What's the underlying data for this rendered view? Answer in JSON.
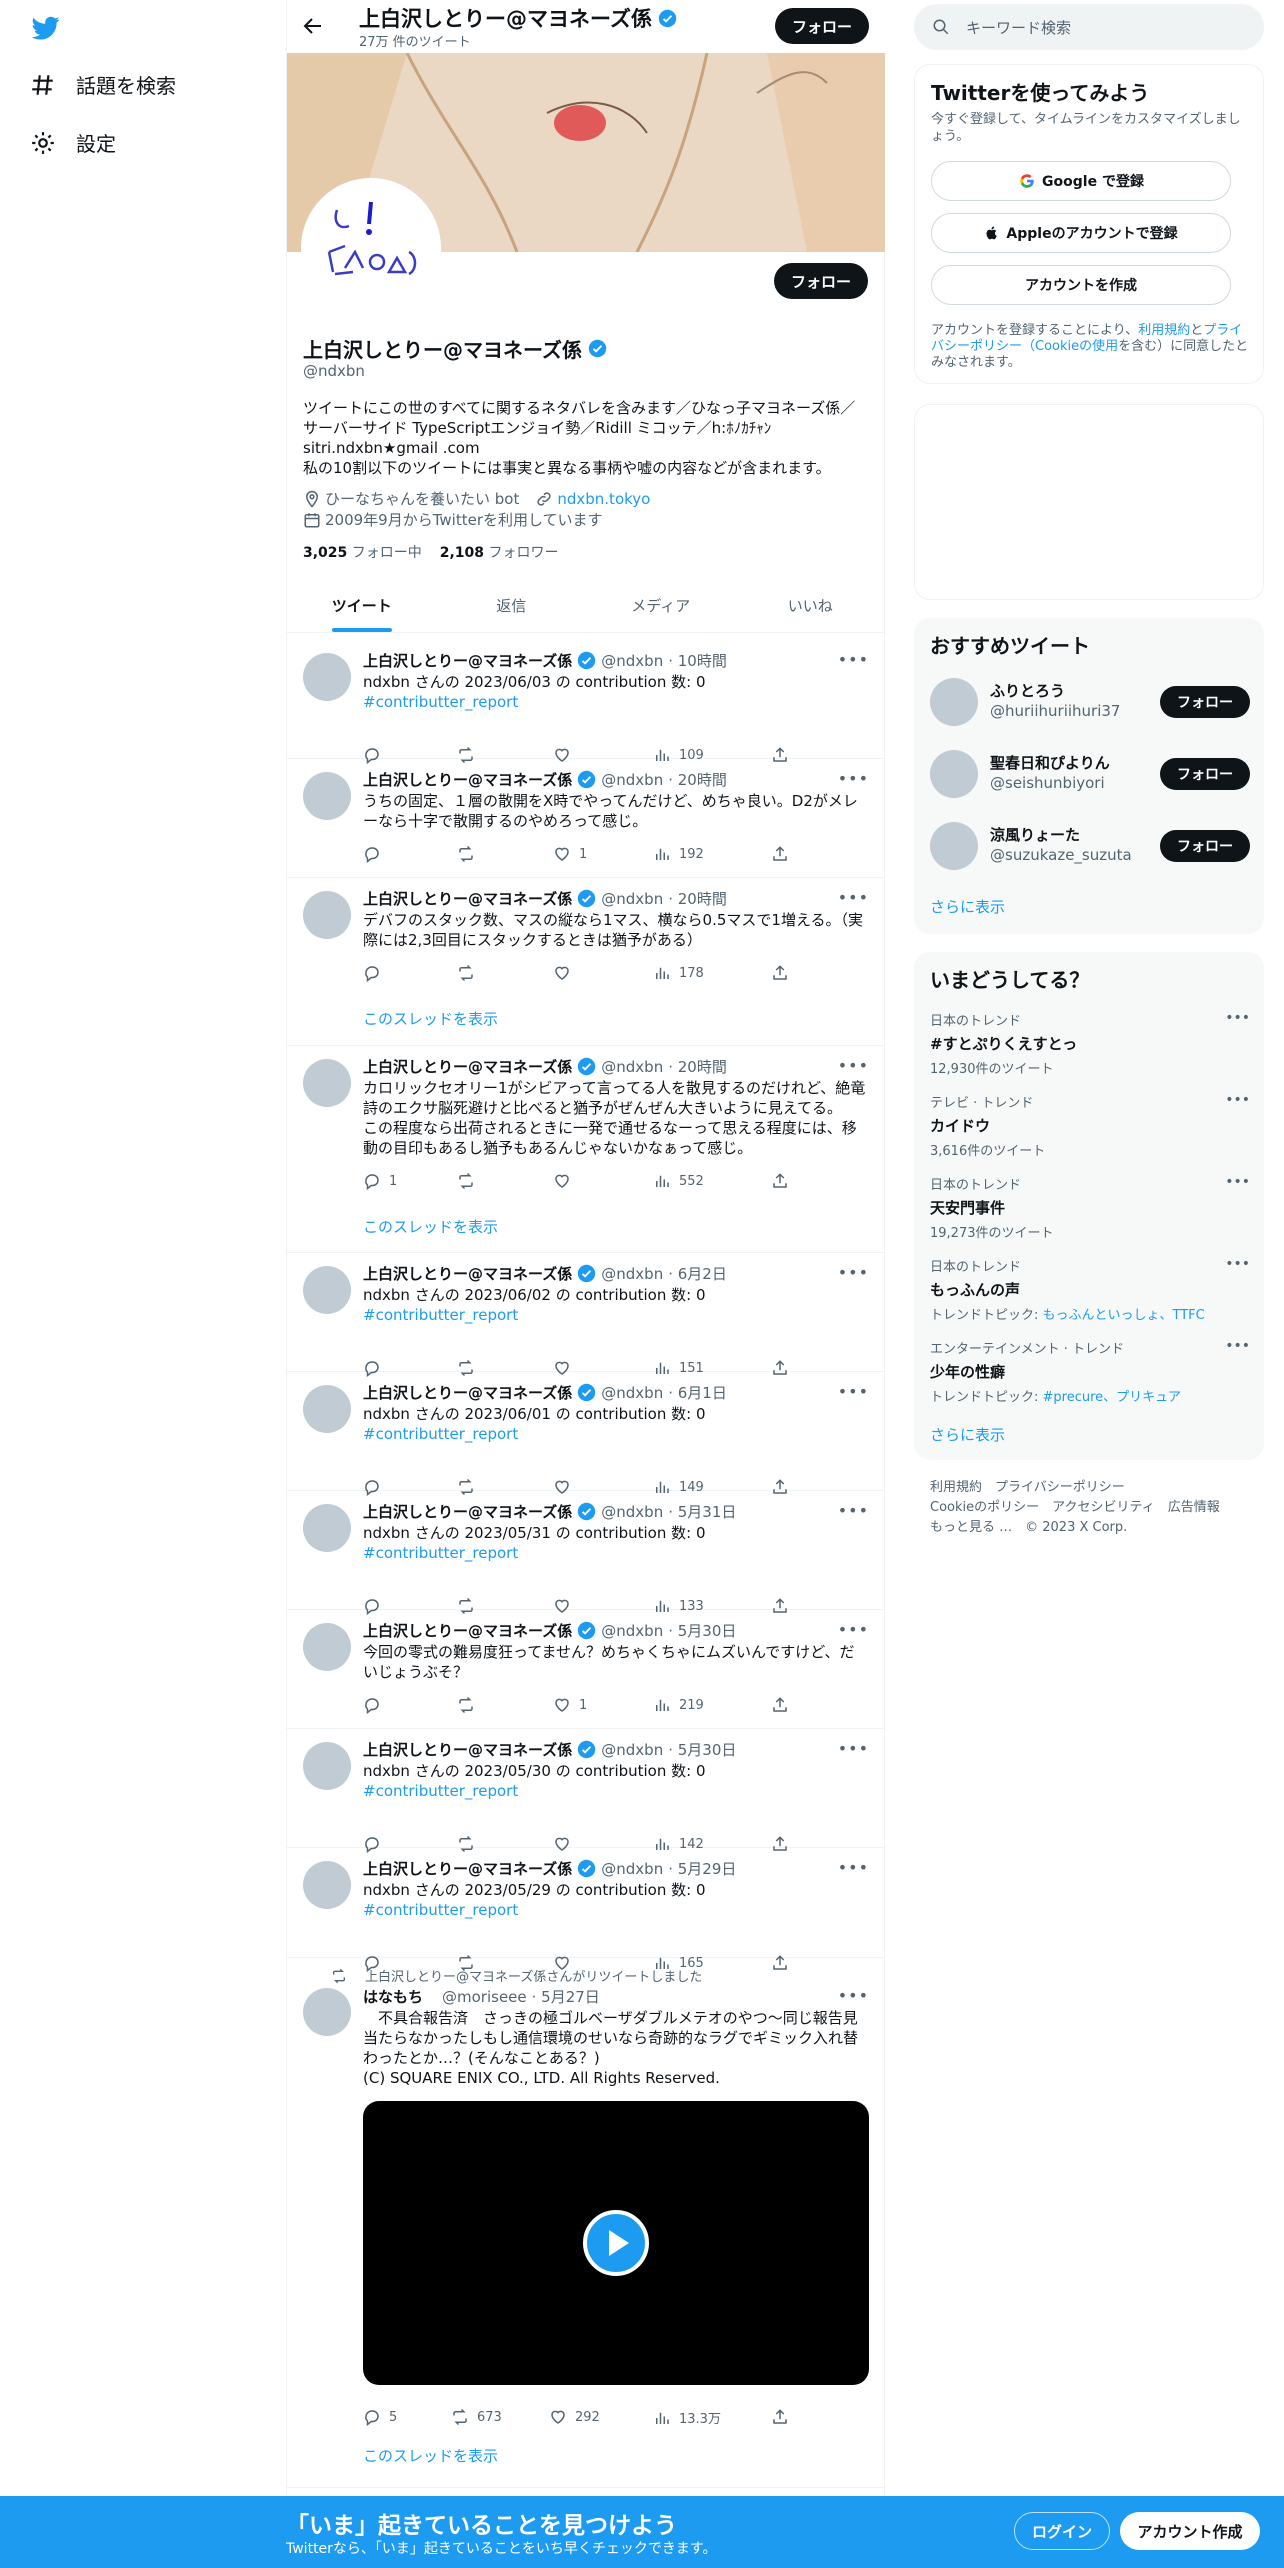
{
  "colors": {
    "accent": "#1d9bf0",
    "text": "#0f1419",
    "muted": "#536471",
    "border": "#eff3f4"
  },
  "nav": {
    "explore": "話題を検索",
    "settings": "設定"
  },
  "header": {
    "name": "上白沢しとりー@マヨネーズ係",
    "tweet_count": "27万 件のツイート",
    "follow": "フォロー"
  },
  "profile": {
    "name": "上白沢しとりー@マヨネーズ係",
    "handle": "@ndxbn",
    "follow": "フォロー",
    "bio": "ツイートにこの世のすべてに関するネタバレを含みます／ひなっ子マヨネーズ係／サーバーサイド TypeScriptエンジョイ勢／Ridill ミコッテ／h:ﾎﾉｶﾁｬﾝ\nsitri.ndxbn★gmail .com\n私の10割以下のツイートには事実と異なる事柄や嘘の内容などが含まれます。",
    "location": "ひーなちゃんを養いたい bot",
    "url": "ndxbn.tokyo",
    "joined": "2009年9月からTwitterを利用しています",
    "following_count": "3,025",
    "following_label": "フォロー中",
    "followers_count": "2,108",
    "followers_label": "フォロワー"
  },
  "tabs": [
    "ツイート",
    "返信",
    "メディア",
    "いいね"
  ],
  "tweets": [
    {
      "name": "上白沢しとりー@マヨネーズ係",
      "handle": "@ndxbn",
      "time": "· 10時間",
      "text": "ndxbn さんの 2023/06/03 の contribution 数: 0",
      "hashtag": "#contributter_report",
      "reply": "",
      "retweet": "",
      "like": "",
      "views": "109"
    },
    {
      "name": "上白沢しとりー@マヨネーズ係",
      "handle": "@ndxbn",
      "time": "· 20時間",
      "text": "うちの固定、１層の散開をX時でやってんだけど、めちゃ良い。D2がメレーなら十字で散開するのやめろって感じ。",
      "reply": "",
      "retweet": "",
      "like": "1",
      "views": "192"
    },
    {
      "name": "上白沢しとりー@マヨネーズ係",
      "handle": "@ndxbn",
      "time": "· 20時間",
      "text": "デバフのスタック数、マスの縦なら1マス、横なら0.5マスで1増える。（実際には2,3回目にスタックするときは猶予がある）",
      "reply": "",
      "retweet": "",
      "like": "",
      "views": "178",
      "thread": "このスレッドを表示"
    },
    {
      "name": "上白沢しとりー@マヨネーズ係",
      "handle": "@ndxbn",
      "time": "· 20時間",
      "text": "カロリックセオリー1がシビアって言ってる人を散見するのだけれど、絶竜詩のエクサ脳死避けと比べると猶予がぜんぜん大きいように見えてる。\nこの程度なら出荷されるときに一発で通せるなーって思える程度には、移動の目印もあるし猶予もあるんじゃないかなぁって感じ。",
      "reply": "1",
      "retweet": "",
      "like": "",
      "views": "552",
      "thread": "このスレッドを表示"
    },
    {
      "name": "上白沢しとりー@マヨネーズ係",
      "handle": "@ndxbn",
      "time": "· 6月2日",
      "text": "ndxbn さんの 2023/06/02 の contribution 数: 0",
      "hashtag": "#contributter_report",
      "reply": "",
      "retweet": "",
      "like": "",
      "views": "151"
    },
    {
      "name": "上白沢しとりー@マヨネーズ係",
      "handle": "@ndxbn",
      "time": "· 6月1日",
      "text": "ndxbn さんの 2023/06/01 の contribution 数: 0",
      "hashtag": "#contributter_report",
      "reply": "",
      "retweet": "",
      "like": "",
      "views": "149"
    },
    {
      "name": "上白沢しとりー@マヨネーズ係",
      "handle": "@ndxbn",
      "time": "· 5月31日",
      "text": "ndxbn さんの 2023/05/31 の contribution 数: 0",
      "hashtag": "#contributter_report",
      "reply": "",
      "retweet": "",
      "like": "",
      "views": "133"
    },
    {
      "name": "上白沢しとりー@マヨネーズ係",
      "handle": "@ndxbn",
      "time": "· 5月30日",
      "text": "今回の零式の難易度狂ってません？めちゃくちゃにムズいんですけど、だいじょうぶそ？",
      "reply": "",
      "retweet": "",
      "like": "1",
      "views": "219"
    },
    {
      "name": "上白沢しとりー@マヨネーズ係",
      "handle": "@ndxbn",
      "time": "· 5月30日",
      "text": "ndxbn さんの 2023/05/30 の contribution 数: 0",
      "hashtag": "#contributter_report",
      "reply": "",
      "retweet": "",
      "like": "",
      "views": "142"
    },
    {
      "name": "上白沢しとりー@マヨネーズ係",
      "handle": "@ndxbn",
      "time": "· 5月29日",
      "text": "ndxbn さんの 2023/05/29 の contribution 数: 0",
      "hashtag": "#contributter_report",
      "reply": "",
      "retweet": "",
      "like": "",
      "views": "165"
    }
  ],
  "retweet": {
    "label": "上白沢しとりー@マヨネーズ係さんがリツイートしました",
    "name": "はなもち",
    "handle": "@moriseee",
    "time": "· 5月27日",
    "text": "　不具合報告済　さっきの極ゴルベーザダブルメテオのやつ〜同じ報告見当たらなかったしもし通信環境のせいなら奇跡的なラグでギミック入れ替わったとか…？(そんなことある？)\n(C) SQUARE ENIX CO., LTD. All Rights Reserved.",
    "reply": "5",
    "retweet": "673",
    "like": "292",
    "views": "13.3万",
    "thread": "このスレッドを表示"
  },
  "search": {
    "placeholder": "キーワード検索"
  },
  "signup": {
    "title": "Twitterを使ってみよう",
    "subtitle": "今すぐ登録して、タイムラインをカスタマイズしましょう。",
    "google": "Google で登録",
    "apple": "Appleのアカウントで登録",
    "create": "アカウントを作成",
    "legal_pre": "アカウントを登録することにより、",
    "legal_terms": "利用規約",
    "legal_and": "と",
    "legal_privacy": "プライバシーポリシー（Cookieの使用",
    "legal_post": "を含む）に同意したとみなされます。"
  },
  "recommend": {
    "title": "おすすめツイート",
    "users": [
      {
        "name": "ふりとろう",
        "handle": "@huriihuriihuri37",
        "button": "フォロー"
      },
      {
        "name": "聖春日和ぴよりん",
        "handle": "@seishunbiyori",
        "button": "フォロー"
      },
      {
        "name": "涼風りょーた",
        "handle": "@suzukaze_suzuta",
        "button": "フォロー"
      }
    ],
    "more": "さらに表示"
  },
  "trends": {
    "title": "いまどうしてる？",
    "items": [
      {
        "category": "日本のトレンド",
        "name": "#すとぷりくえすとっ",
        "sub": "12,930件のツイート"
      },
      {
        "category": "テレビ · トレンド",
        "name": "カイドウ",
        "sub": "3,616件のツイート"
      },
      {
        "category": "日本のトレンド",
        "name": "天安門事件",
        "sub": "19,273件のツイート"
      },
      {
        "category": "日本のトレンド",
        "name": "もっふんの声",
        "sub_pre": "トレンドトピック: ",
        "sub_links": "もっふんといっしょ、TTFC"
      },
      {
        "category": "エンターテインメント · トレンド",
        "name": "少年の性癖",
        "sub_pre": "トレンドトピック: ",
        "sub_links": "#precure、プリキュア"
      }
    ],
    "more": "さらに表示"
  },
  "footer": {
    "line1": "利用規約　プライバシーポリシー",
    "line2": "Cookieのポリシー　アクセシビリティ　広告情報",
    "line3": "もっと見る …　© 2023 X Corp."
  },
  "bottom": {
    "title": "「いま」起きていることを見つけよう",
    "subtitle": "Twitterなら、「いま」起きていることをいち早くチェックできます。",
    "login": "ログイン",
    "signup": "アカウント作成"
  }
}
